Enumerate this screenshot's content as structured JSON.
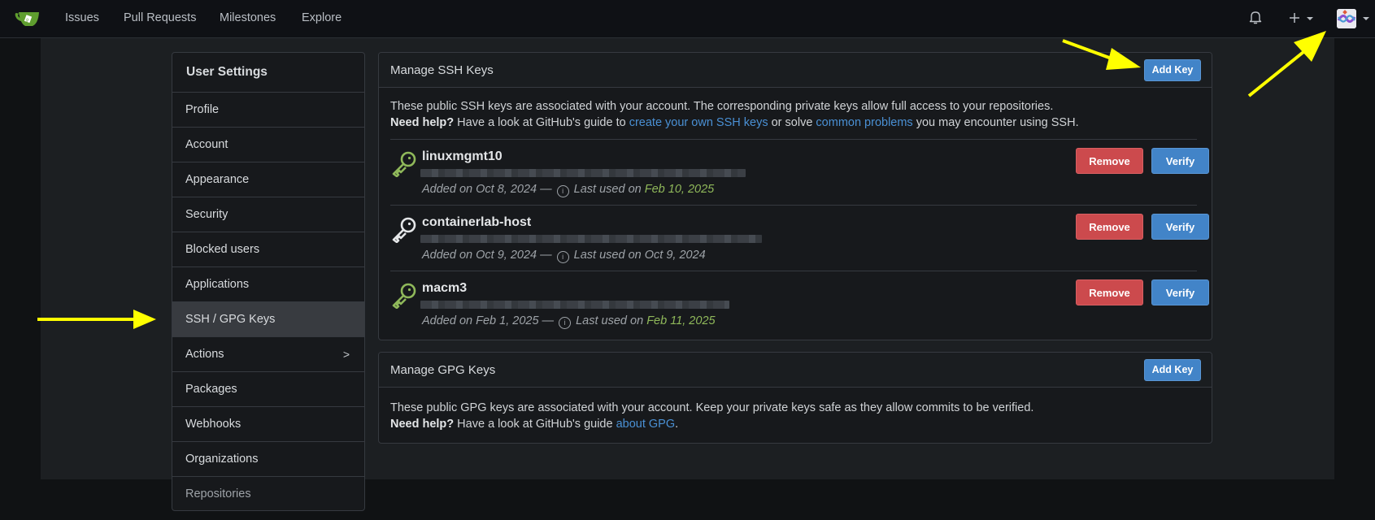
{
  "navbar": {
    "logo": "gitea-teacup-logo",
    "links": [
      "Issues",
      "Pull Requests",
      "Milestones",
      "Explore"
    ],
    "icons": [
      "bell-icon",
      "plus-icon",
      "avatar"
    ]
  },
  "sidebar": {
    "header": "User Settings",
    "items": [
      {
        "label": "Profile"
      },
      {
        "label": "Account"
      },
      {
        "label": "Appearance"
      },
      {
        "label": "Security"
      },
      {
        "label": "Blocked users"
      },
      {
        "label": "Applications"
      },
      {
        "label": "SSH / GPG Keys",
        "active": true
      },
      {
        "label": "Actions",
        "chevron": ">"
      },
      {
        "label": "Packages"
      },
      {
        "label": "Webhooks"
      },
      {
        "label": "Organizations"
      },
      {
        "label": "Repositories"
      }
    ]
  },
  "ssh": {
    "title": "Manage SSH Keys",
    "add_label": "Add Key",
    "desc_line1": "These public SSH keys are associated with your account. The corresponding private keys allow full access to your repositories.",
    "help_bold": "Need help?",
    "help_pre": " Have a look at GitHub's guide to ",
    "help_link1": "create your own SSH keys",
    "help_mid": " or solve ",
    "help_link2": "common problems",
    "help_post": " you may encounter using SSH.",
    "keys": [
      {
        "name": "linuxmgmt10",
        "added": "Added on Oct 8, 2024 —",
        "last_used_label": "Last used on",
        "last_used": "Feb 10, 2025",
        "recent": true,
        "remove": "Remove",
        "verify": "Verify"
      },
      {
        "name": "containerlab-host",
        "added": "Added on Oct 9, 2024 —",
        "last_used_label": "Last used on",
        "last_used": "Oct 9, 2024",
        "recent": false,
        "remove": "Remove",
        "verify": "Verify"
      },
      {
        "name": "macm3",
        "added": "Added on Feb 1, 2025 —",
        "last_used_label": "Last used on",
        "last_used": "Feb 11, 2025",
        "recent": true,
        "remove": "Remove",
        "verify": "Verify"
      }
    ]
  },
  "gpg": {
    "title": "Manage GPG Keys",
    "add_label": "Add Key",
    "desc_line1": "These public GPG keys are associated with your account. Keep your private keys safe as they allow commits to be verified.",
    "help_bold": "Need help?",
    "help_pre": " Have a look at GitHub's guide ",
    "help_link": "about GPG",
    "help_post": "."
  },
  "colors": {
    "accent_blue": "#4284c8",
    "danger_red": "#cc4a4d",
    "recent_green": "#8fb85a",
    "annotation_yellow": "#ffff00"
  }
}
